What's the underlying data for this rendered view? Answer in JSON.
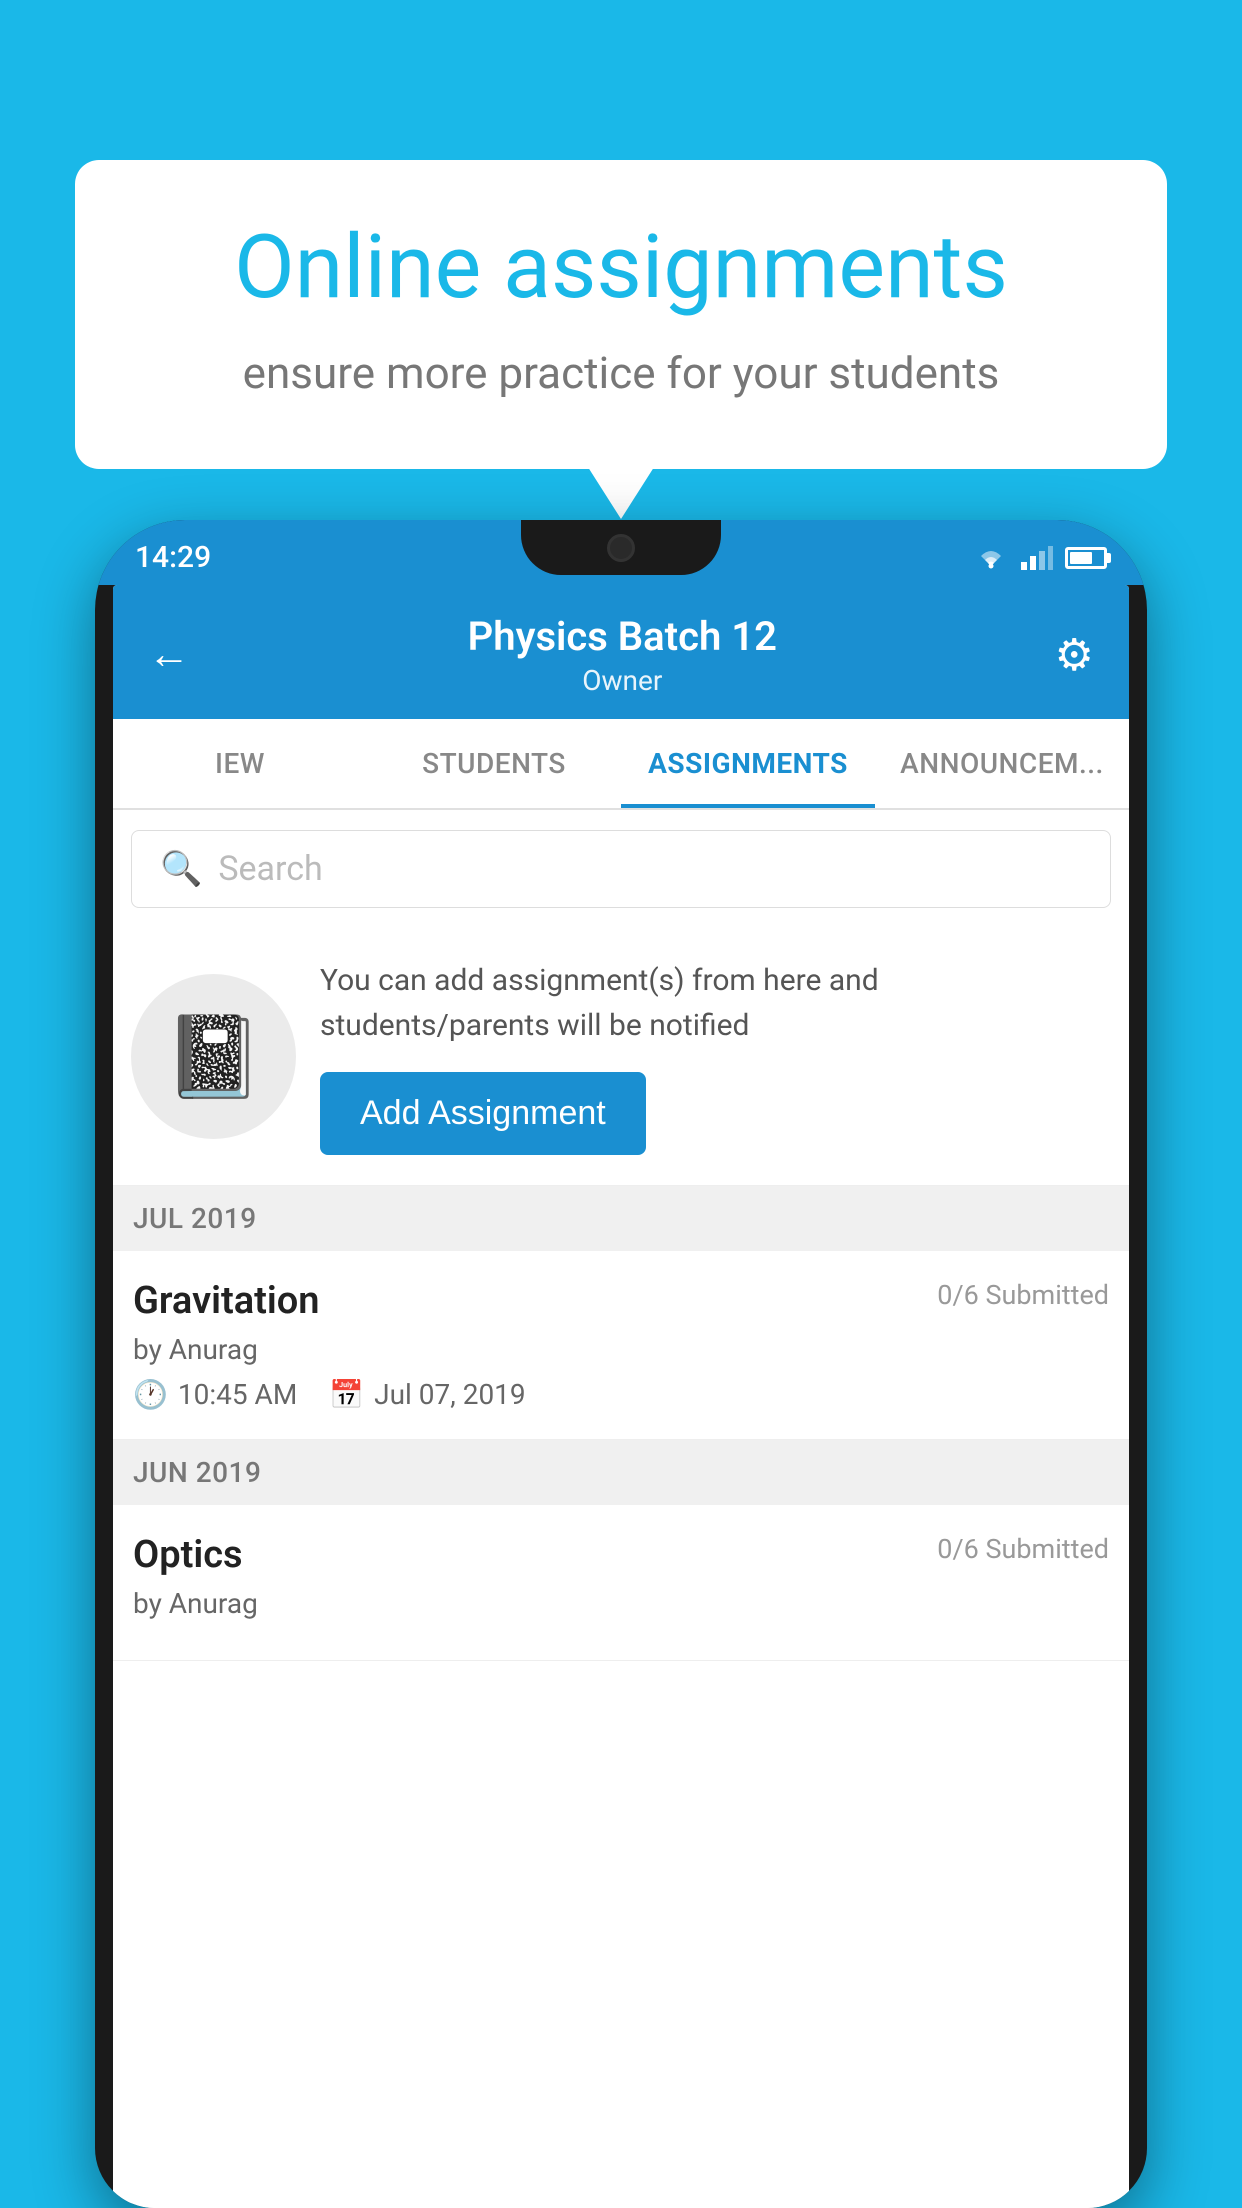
{
  "background": {
    "color": "#1ab8e8"
  },
  "speech_bubble": {
    "title": "Online assignments",
    "subtitle": "ensure more practice for your students"
  },
  "status_bar": {
    "time": "14:29"
  },
  "app_header": {
    "title": "Physics Batch 12",
    "subtitle": "Owner",
    "back_label": "←",
    "gear_label": "⚙"
  },
  "tabs": [
    {
      "label": "IEW",
      "active": false
    },
    {
      "label": "STUDENTS",
      "active": false
    },
    {
      "label": "ASSIGNMENTS",
      "active": true
    },
    {
      "label": "ANNOUNCEM...",
      "active": false
    }
  ],
  "search": {
    "placeholder": "Search"
  },
  "promo": {
    "text": "You can add assignment(s) from here and students/parents will be notified",
    "button_label": "Add Assignment"
  },
  "sections": [
    {
      "label": "JUL 2019",
      "assignments": [
        {
          "title": "Gravitation",
          "submitted": "0/6 Submitted",
          "author": "by Anurag",
          "time": "10:45 AM",
          "date": "Jul 07, 2019"
        }
      ]
    },
    {
      "label": "JUN 2019",
      "assignments": [
        {
          "title": "Optics",
          "submitted": "0/6 Submitted",
          "author": "by Anurag",
          "time": "",
          "date": ""
        }
      ]
    }
  ]
}
